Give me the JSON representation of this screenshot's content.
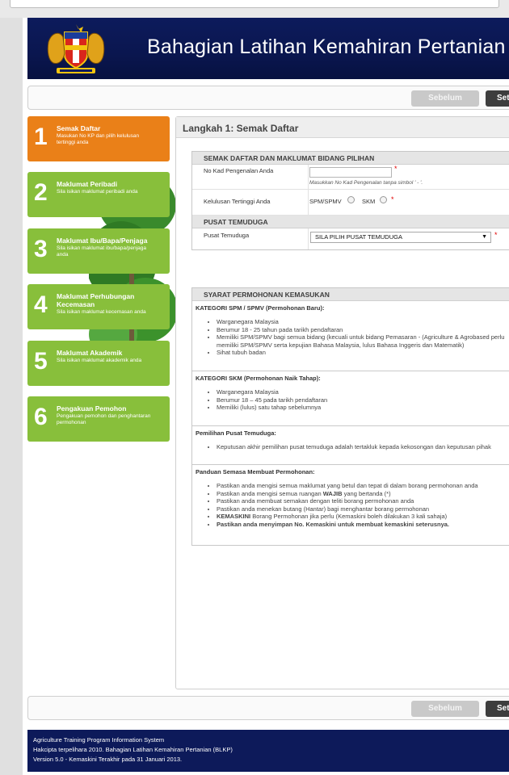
{
  "header": {
    "title": "Bahagian Latihan Kemahiran Pertanian",
    "crest_icon": "malaysia-coat-of-arms",
    "colors": {
      "header_bg": "#0d1b5c",
      "active_step": "#ea8018",
      "step": "#88bf3b"
    }
  },
  "nav": {
    "prev_label": "Sebelum",
    "next_label": "Seterusnya"
  },
  "steps": [
    {
      "num": "1",
      "title": "Semak Daftar",
      "desc": "Masukan No KP dan pilih kelulusan tertinggi anda",
      "active": true
    },
    {
      "num": "2",
      "title": "Maklumat Peribadi",
      "desc": "Sila isikan maklumat peribadi anda"
    },
    {
      "num": "3",
      "title": "Maklumat Ibu/Bapa/Penjaga",
      "desc": "Sila isikan maklumat ibu/bapa/penjaga anda"
    },
    {
      "num": "4",
      "title": "Maklumat Perhubungan Kecemasan",
      "desc": "Sila isikan maklumat kecemasan anda"
    },
    {
      "num": "5",
      "title": "Maklumat Akademik",
      "desc": "Sila isikan maklumat akademik anda"
    },
    {
      "num": "6",
      "title": "Pengakuan Pemohon",
      "desc": "Pengakuan pemohon dan penghantaran permohonan"
    }
  ],
  "content": {
    "title": "Langkah 1: Semak Daftar",
    "section1": {
      "heading": "SEMAK DAFTAR DAN MAKLUMAT BIDANG PILIHAN",
      "nokp_label": "No Kad Pengenalan Anda",
      "nokp_value": "",
      "nokp_hint": "Masukkan No Kad Pengenalan tanpa simbol ' - '.",
      "kelulusan_label": "Kelulusan Tertinggi Anda",
      "opt_spm": "SPM/SPMV",
      "opt_skm": "SKM",
      "required_mark": "*"
    },
    "section2": {
      "heading": "PUSAT TEMUDUGA",
      "label": "Pusat Temuduga",
      "selected": "SILA PILIH PUSAT TEMUDUGA",
      "caret": "▼"
    },
    "syarat": {
      "heading": "SYARAT PERMOHONAN KEMASUKAN",
      "spm_title": "KATEGORI SPM / SPMV (Permohonan Baru):",
      "spm_items": [
        "Warganegara Malaysia",
        "Berumur 18 - 25 tahun pada tarikh pendaftaran",
        "Memiliki SPM/SPMV bagi semua bidang (kecuali untuk bidang Pemasaran - (Agriculture & Agrobased perlu memiliki SPM/SPMV serta kepujian Bahasa Malaysia, lulus Bahasa Inggeris dan Matematik)",
        "Sihat tubuh badan"
      ],
      "skm_title": "KATEGORI SKM (Permohonan Naik Tahap):",
      "skm_items": [
        "Warganegara Malaysia",
        "Berumur 18 – 45 pada tarikh pendaftaran",
        "Memiliki (lulus) satu tahap sebelumnya"
      ],
      "pusat_title": "Pemilihan Pusat Temuduga:",
      "pusat_items": [
        "Keputusan akhir pemilihan pusat temuduga adalah tertakluk kepada kekosongan dan keputusan pihak"
      ],
      "panduan_title": "Panduan Semasa Membuat Permohonan:",
      "panduan_items": [
        "Pastikan anda mengisi semua maklumat yang betul dan tepat di dalam borang permohonan anda",
        "Pastikan anda mengisi semua ruangan",
        "WAJIB",
        "yang bertanda (*)",
        "Pastikan anda membuat semakan dengan teliti borang permohonan anda",
        "Pastikan anda menekan butang (Hantar) bagi menghantar borang permohonan",
        "KEMASKINI",
        "Borang Permohonan jika perlu (Kemaskini boleh dilakukan 3 kali sahaja)",
        "Pastikan anda menyimpan No. Kemaskini untuk membuat kemaskini seterusnya."
      ]
    }
  },
  "footer": {
    "line1": "Agriculture Training Program Information System",
    "line2": "Hakcipta terpelihara 2010. Bahagian Latihan Kemahiran Pertanian (BLKP)",
    "line3": "Version 5.0 - Kemaskini Terakhir pada 31 Januari 2013."
  }
}
